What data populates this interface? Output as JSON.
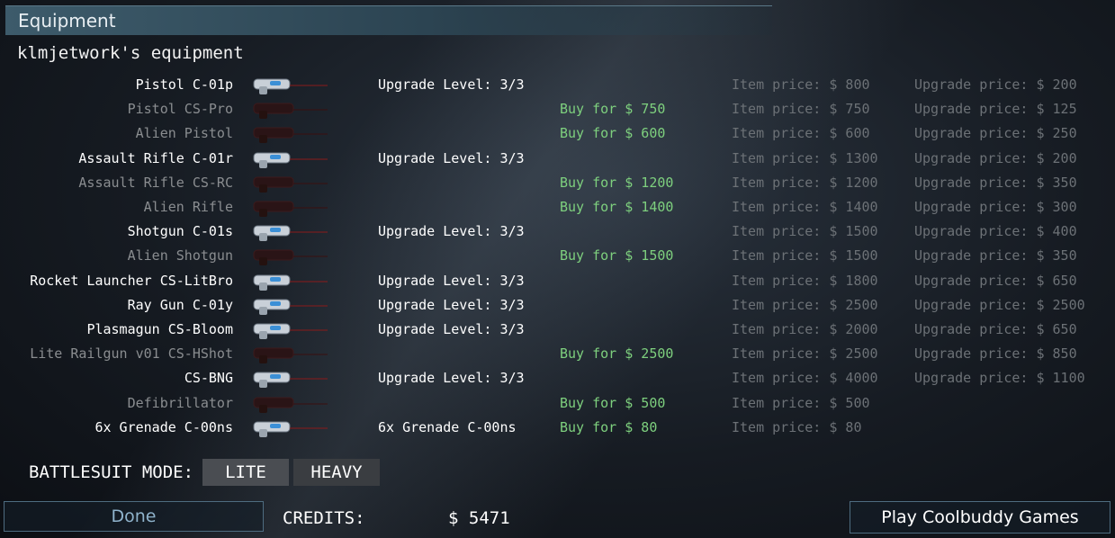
{
  "window": {
    "title": "Equipment"
  },
  "subtitle": "klmjetwork's equipment",
  "items": [
    {
      "name": "Pistol C-01p",
      "owned": true,
      "upgrade": "Upgrade Level: 3/3",
      "buy": "",
      "item_price": "Item price: $ 800",
      "upgrade_price": "Upgrade price: $ 200",
      "icon": "pistol-icon"
    },
    {
      "name": "Pistol CS-Pro",
      "owned": false,
      "upgrade": "",
      "buy": "Buy for $ 750",
      "item_price": "Item price: $ 750",
      "upgrade_price": "Upgrade price: $ 125",
      "icon": "pistol-icon"
    },
    {
      "name": "Alien Pistol",
      "owned": false,
      "upgrade": "",
      "buy": "Buy for $ 600",
      "item_price": "Item price: $ 600",
      "upgrade_price": "Upgrade price: $ 250",
      "icon": "alien-pistol-icon"
    },
    {
      "name": "Assault Rifle C-01r",
      "owned": true,
      "upgrade": "Upgrade Level: 3/3",
      "buy": "",
      "item_price": "Item price: $ 1300",
      "upgrade_price": "Upgrade price: $ 200",
      "icon": "assault-rifle-icon"
    },
    {
      "name": "Assault Rifle CS-RC",
      "owned": false,
      "upgrade": "",
      "buy": "Buy for $ 1200",
      "item_price": "Item price: $ 1200",
      "upgrade_price": "Upgrade price: $ 350",
      "icon": "assault-rifle-icon"
    },
    {
      "name": "Alien Rifle",
      "owned": false,
      "upgrade": "",
      "buy": "Buy for $ 1400",
      "item_price": "Item price: $ 1400",
      "upgrade_price": "Upgrade price: $ 300",
      "icon": "alien-rifle-icon"
    },
    {
      "name": "Shotgun C-01s",
      "owned": true,
      "upgrade": "Upgrade Level: 3/3",
      "buy": "",
      "item_price": "Item price: $ 1500",
      "upgrade_price": "Upgrade price: $ 400",
      "icon": "shotgun-icon"
    },
    {
      "name": "Alien Shotgun",
      "owned": false,
      "upgrade": "",
      "buy": "Buy for $ 1500",
      "item_price": "Item price: $ 1500",
      "upgrade_price": "Upgrade price: $ 350",
      "icon": "alien-shotgun-icon"
    },
    {
      "name": "Rocket Launcher CS-LitBro",
      "owned": true,
      "upgrade": "Upgrade Level: 3/3",
      "buy": "",
      "item_price": "Item price: $ 1800",
      "upgrade_price": "Upgrade price: $ 650",
      "icon": "rocket-launcher-icon"
    },
    {
      "name": "Ray Gun C-01y",
      "owned": true,
      "upgrade": "Upgrade Level: 3/3",
      "buy": "",
      "item_price": "Item price: $ 2500",
      "upgrade_price": "Upgrade price: $ 2500",
      "icon": "ray-gun-icon"
    },
    {
      "name": "Plasmagun CS-Bloom",
      "owned": true,
      "upgrade": "Upgrade Level: 3/3",
      "buy": "",
      "item_price": "Item price: $ 2000",
      "upgrade_price": "Upgrade price: $ 650",
      "icon": "plasmagun-icon"
    },
    {
      "name": "Lite Railgun v01 CS-HShot",
      "owned": false,
      "upgrade": "",
      "buy": "Buy for $ 2500",
      "item_price": "Item price: $ 2500",
      "upgrade_price": "Upgrade price: $ 850",
      "icon": "railgun-icon"
    },
    {
      "name": "CS-BNG",
      "owned": true,
      "upgrade": "Upgrade Level: 3/3",
      "buy": "",
      "item_price": "Item price: $ 4000",
      "upgrade_price": "Upgrade price: $ 1100",
      "icon": "bng-gun-icon"
    },
    {
      "name": "Defibrillator",
      "owned": false,
      "upgrade": "",
      "buy": "Buy for $ 500",
      "item_price": "Item price: $ 500",
      "upgrade_price": "",
      "icon": "defibrillator-icon"
    },
    {
      "name": "6x Grenade C-00ns",
      "owned": true,
      "upgrade": "6x Grenade C-00ns",
      "buy": "Buy for $ 80",
      "item_price": "Item price: $ 80",
      "upgrade_price": "",
      "icon": "grenade-icon"
    }
  ],
  "battlesuit": {
    "label": "BATTLESUIT MODE:",
    "lite": "LITE",
    "heavy": "HEAVY"
  },
  "footer": {
    "done": "Done",
    "credits_label": "CREDITS:",
    "credits_value": "$ 5471",
    "play": "Play Coolbuddy Games"
  }
}
